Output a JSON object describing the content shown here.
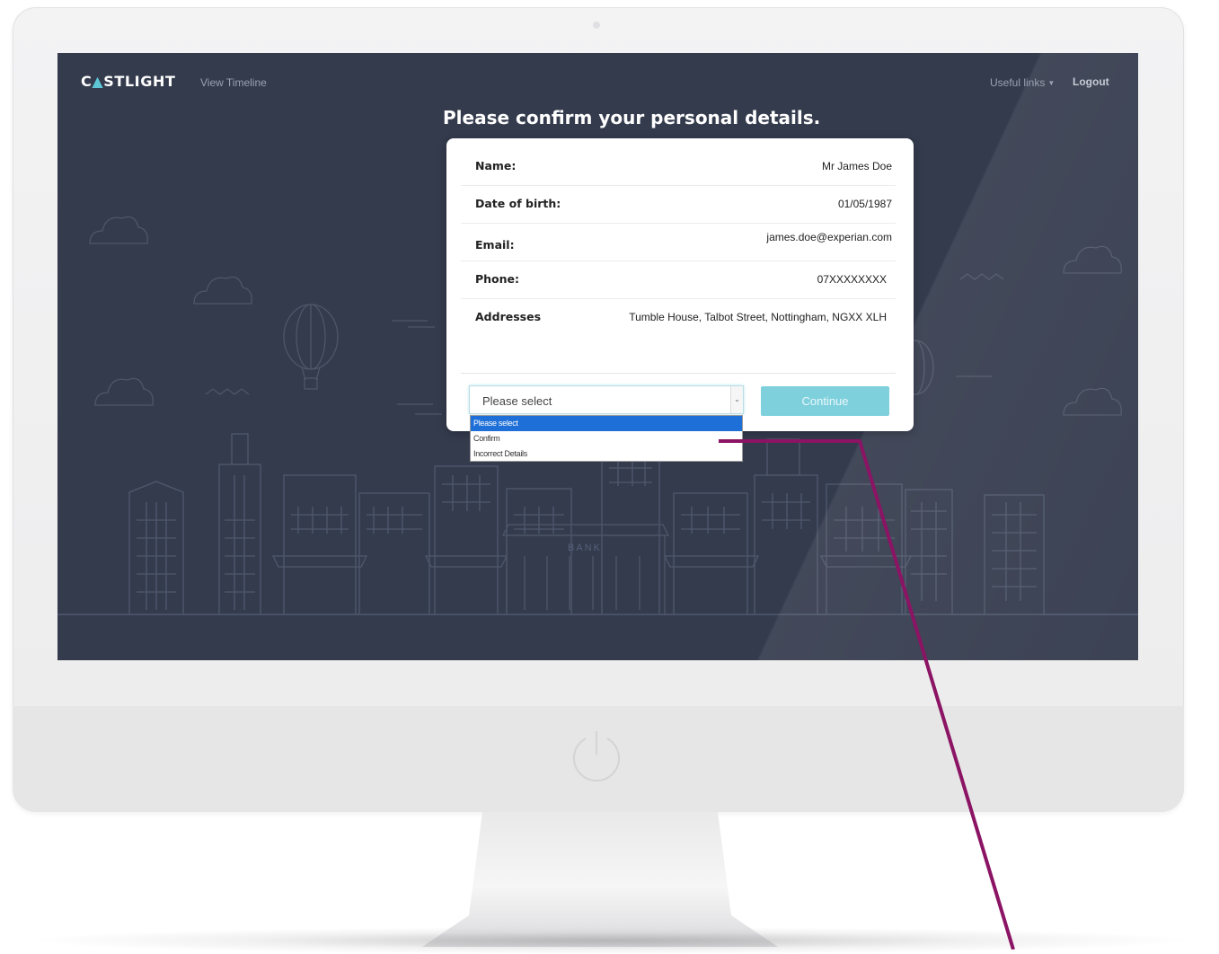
{
  "nav": {
    "logo_text_a": "C",
    "logo_text_b": "STLIGHT",
    "logo_triangle": "▲",
    "view_timeline": "View Timeline",
    "useful_links": "Useful links",
    "logout": "Logout"
  },
  "page": {
    "heading": "Please confirm your personal details."
  },
  "details": [
    {
      "label": "Name:",
      "value": "Mr James Doe"
    },
    {
      "label": "Date of birth:",
      "value": "01/05/1987"
    },
    {
      "label": "Email:",
      "value": "james.doe@experian.com"
    },
    {
      "label": "Phone:",
      "value": "07XXXXXXXX"
    },
    {
      "label": "Addresses",
      "value": "Tumble House, Talbot Street, Nottingham, NGXX XLH"
    }
  ],
  "select": {
    "selected": "Please select",
    "options": [
      "Please select",
      "Confirm",
      "Incorrect Details"
    ]
  },
  "continue_label": "Continue",
  "illustration": {
    "bank_sign": "BANK"
  },
  "colors": {
    "screen_bg": "#343b4d",
    "accent": "#5fc6d6",
    "button": "#7fd0dd",
    "dropdown_highlight": "#1e6fd8",
    "annotation_line": "#8b1464"
  }
}
